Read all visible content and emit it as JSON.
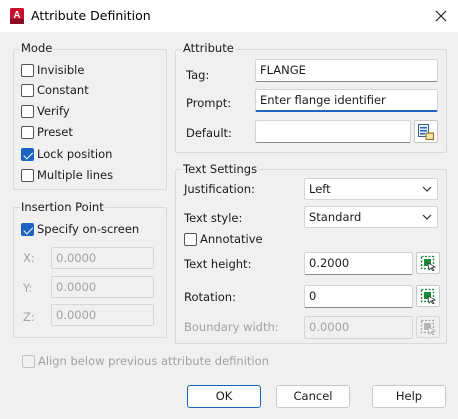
{
  "window": {
    "title": "Attribute Definition",
    "app_icon_letter": "A"
  },
  "mode": {
    "group_label": "Mode",
    "items": [
      {
        "label": "Invisible",
        "checked": false
      },
      {
        "label": "Constant",
        "checked": false
      },
      {
        "label": "Verify",
        "checked": false
      },
      {
        "label": "Preset",
        "checked": false
      },
      {
        "label": "Lock position",
        "checked": true
      },
      {
        "label": "Multiple lines",
        "checked": false
      }
    ]
  },
  "attribute": {
    "group_label": "Attribute",
    "tag_label": "Tag:",
    "tag_value": "FLANGE",
    "prompt_label": "Prompt:",
    "prompt_value": "Enter flange identifier",
    "default_label": "Default:",
    "default_value": ""
  },
  "insertion": {
    "group_label": "Insertion Point",
    "specify_label": "Specify on-screen",
    "specify_checked": true,
    "x_label": "X:",
    "x_value": "0.0000",
    "y_label": "Y:",
    "y_value": "0.0000",
    "z_label": "Z:",
    "z_value": "0.0000"
  },
  "text_settings": {
    "group_label": "Text Settings",
    "justification_label": "Justification:",
    "justification_value": "Left",
    "style_label": "Text style:",
    "style_value": "Standard",
    "annotative_label": "Annotative",
    "annotative_checked": false,
    "height_label": "Text height:",
    "height_value": "0.2000",
    "rotation_label": "Rotation:",
    "rotation_value": "0",
    "boundary_label": "Boundary width:",
    "boundary_value": "0.0000"
  },
  "align_below": {
    "label": "Align below previous attribute definition",
    "checked": false,
    "enabled": false
  },
  "buttons": {
    "ok": "OK",
    "cancel": "Cancel",
    "help": "Help"
  },
  "colors": {
    "accent": "#1d64c2",
    "app_icon": "#c8102e",
    "pick_icon": "#1a8a3c"
  }
}
